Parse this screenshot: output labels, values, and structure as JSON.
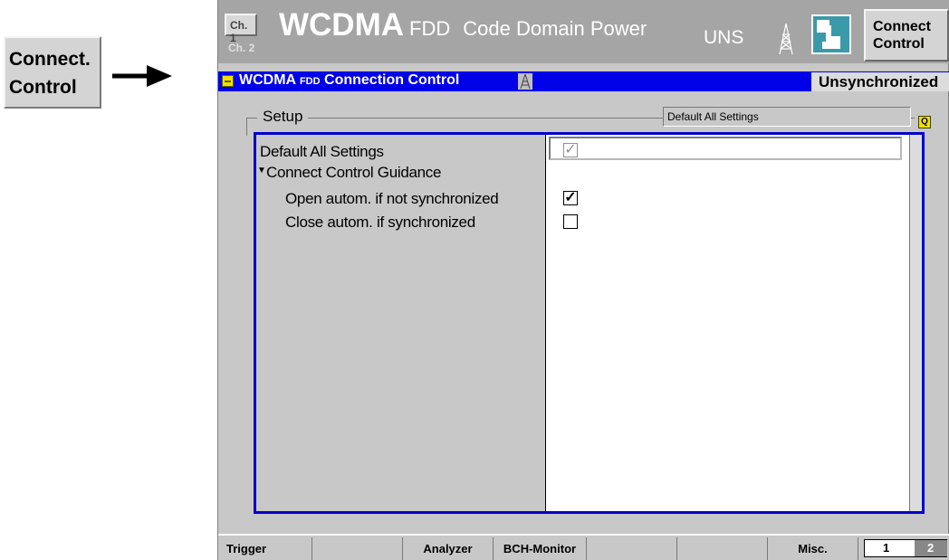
{
  "left_key": {
    "line1": "Connect.",
    "line2": "Control"
  },
  "header": {
    "ch1": "Ch. 1",
    "ch2": "Ch. 2",
    "title_main": "WCDMA",
    "title_fdd": "FDD",
    "title_mode": "Code Domain Power",
    "status_short": "UNS",
    "connect_line1": "Connect",
    "connect_line2": "Control"
  },
  "titlebar": {
    "title_main": "WCDMA",
    "title_fdd": "FDD",
    "title_rest": "Connection Control",
    "status": "Unsynchronized"
  },
  "setup": {
    "label": "Setup",
    "default_field": "Default All Settings",
    "q_icon": "Q"
  },
  "table": {
    "rows": [
      {
        "label": "Default All Settings",
        "checked": true,
        "check_glyph": "✓"
      },
      {
        "label": "Connect Control Guidance",
        "expander": "▼"
      },
      {
        "label": "Open autom. if not synchronized",
        "checked": true,
        "check_glyph": "✓"
      },
      {
        "label": "Close autom. if synchronized",
        "checked": false,
        "check_glyph": ""
      }
    ]
  },
  "softkeys": [
    "Trigger",
    "",
    "Analyzer",
    "BCH-Monitor",
    "",
    "",
    "Misc."
  ],
  "pages": {
    "p1": "1",
    "p2": "2"
  },
  "colors": {
    "titlebar": "#0000e8",
    "topbar": "#a5a5a5",
    "accent_yellow": "#f0e000"
  },
  "icons": [
    "arrow-right-icon",
    "tower-icon",
    "hand-touch-icon",
    "menu-icon",
    "q-icon"
  ]
}
